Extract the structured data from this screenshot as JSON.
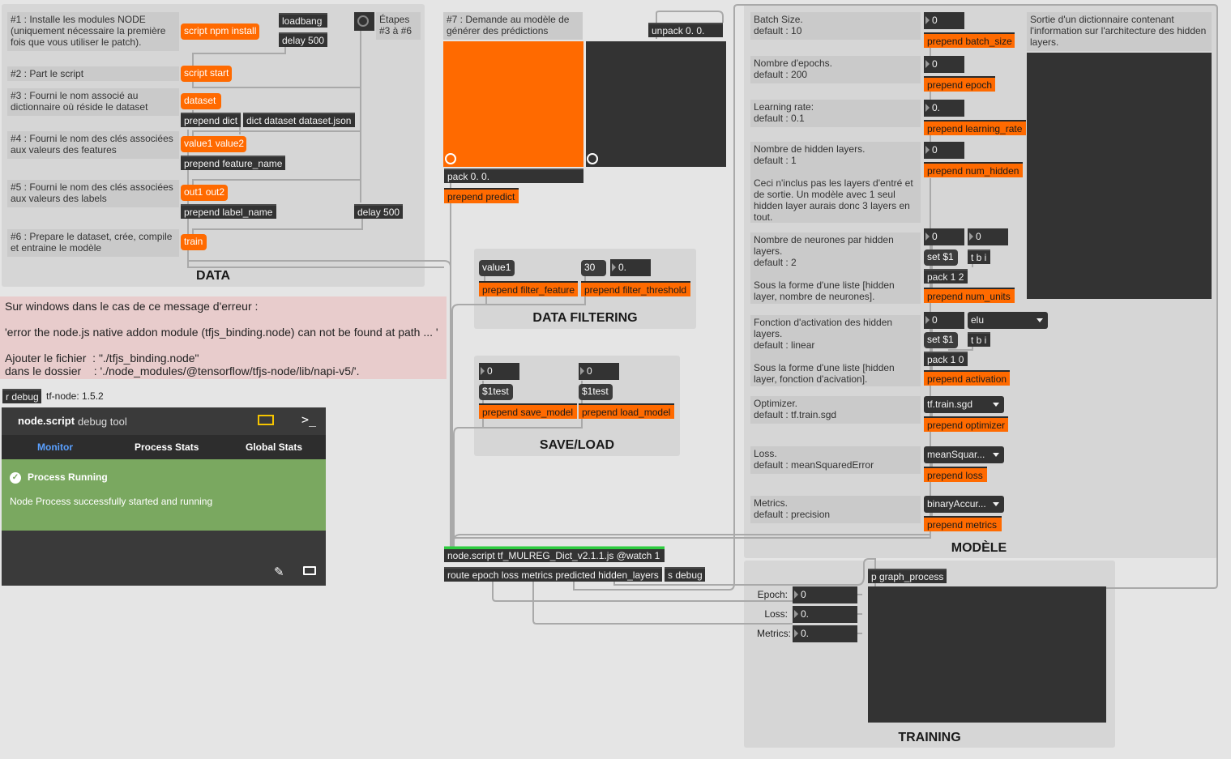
{
  "data_panel": {
    "title": "DATA",
    "comments": {
      "c1": "#1 : Installe les modules NODE (uniquement nécessaire la première fois que vous utiliser le patch).",
      "c2": "#2 : Part le script",
      "c3": "#3 : Fourni le nom associé au dictionnaire où réside le dataset",
      "c4": "#4 : Fourni le nom des clés associées aux valeurs des features",
      "c5": "#5 : Fourni le nom des clés associées aux valeurs des labels",
      "c6": "#6 : Prepare le dataset, crée, compile et entraine le modèle",
      "steps": "Étapes\n#3 à #6"
    },
    "messages": {
      "npm_install": "script npm install",
      "start": "script start",
      "dataset": "dataset",
      "features": "value1 value2",
      "labels": "out1 out2",
      "train": "train"
    },
    "objects": {
      "loadbang": "loadbang",
      "delay1": "delay 500",
      "prepend_dict": "prepend dict",
      "dict": "dict dataset dataset.json",
      "prepend_feature": "prepend feature_name",
      "prepend_label": "prepend label_name",
      "delay2": "delay 500"
    }
  },
  "predict": {
    "comment": "#7 : Demande au modèle de générer des prédictions",
    "unpack": "unpack 0. 0.",
    "pack": "pack 0. 0.",
    "prepend": "prepend predict"
  },
  "filtering": {
    "title": "DATA FILTERING",
    "value_msg": "value1",
    "threshold_msg": "30",
    "threshold_num": "0.",
    "prepend_feature": "prepend filter_feature",
    "prepend_threshold": "prepend filter_threshold"
  },
  "saveload": {
    "title": "SAVE/LOAD",
    "num1": "0",
    "num2": "0",
    "msg1": "$1test",
    "msg2": "$1test",
    "prepend_save": "prepend save_model",
    "prepend_load": "prepend load_model"
  },
  "error_note": {
    "text": "Sur windows dans le cas de ce message d'erreur :\n\n'error the node.js native addon module (tfjs_binding.node) can not be found at path ... '\n\nAjouter le fichier  : \"./tfjs_binding.node\"\ndans le dossier    : './node_modules/@tensorflow/tfjs-node/lib/napi-v5/'."
  },
  "debug": {
    "receive": "r debug",
    "version": "tf-node: 1.5.2",
    "brand": "node.script",
    "brand_sub": "debug tool",
    "tabs": [
      "Monitor",
      "Process Stats",
      "Global Stats"
    ],
    "status_title": "Process Running",
    "status_text": "Node Process successfully started and running",
    "colors": {
      "accent": "#5aa0ff",
      "status_bg": "#7aa860",
      "header_bg": "#3a3a3a"
    }
  },
  "model_panel": {
    "title": "MODÈLE",
    "batch": {
      "comment": "Batch Size.\ndefault : 10",
      "num": "0",
      "prepend": "prepend batch_size"
    },
    "epoch": {
      "comment": "Nombre d'epochs.\ndefault : 200",
      "num": "0",
      "prepend": "prepend epoch"
    },
    "lr": {
      "comment": "Learning rate:\ndefault : 0.1",
      "num": "0.",
      "prepend": "prepend learning_rate"
    },
    "hidden": {
      "comment": "Nombre de hidden layers.\ndefault : 1\n\nCeci n'inclus pas les layers d'entré et de sortie. Un modèle avec 1 seul hidden layer aurais donc 3 layers en tout.",
      "num": "0",
      "prepend": "prepend num_hidden"
    },
    "units": {
      "comment": "Nombre de neurones par hidden layers.\ndefault : 2\n\nSous la forme d'une liste [hidden layer, nombre de neurones].",
      "num1": "0",
      "num2": "0",
      "set": "set $1",
      "tbi": "t b i",
      "pack": "pack 1 2",
      "prepend": "prepend num_units"
    },
    "activation": {
      "comment": "Fonction d'activation des hidden layers.\ndefault : linear\n\nSous la forme d'une liste [hidden layer, fonction d'acivation].",
      "num": "0",
      "menu": "elu",
      "set": "set $1",
      "tbi": "t b i",
      "pack": "pack 1 0",
      "prepend": "prepend activation"
    },
    "optimizer": {
      "comment": "Optimizer.\ndefault : tf.train.sgd",
      "menu": "tf.train.sgd",
      "prepend": "prepend optimizer"
    },
    "loss": {
      "comment": "Loss.\ndefault : meanSquaredError",
      "menu": "meanSquar...",
      "prepend": "prepend loss"
    },
    "metrics": {
      "comment": "Metrics.\ndefault : precision",
      "menu": "binaryAccur...",
      "prepend": "prepend metrics"
    },
    "output_comment": "Sortie d'un dictionnaire contenant l'information sur l'architecture des hidden layers."
  },
  "node_script": {
    "main": "node.script tf_MULREG_Dict_v2.1.1.js @watch 1",
    "route": "route epoch loss metrics predicted hidden_layers",
    "send_debug": "s debug"
  },
  "training": {
    "title": "TRAINING",
    "graph": "p graph_process",
    "labels": [
      "Epoch:",
      "Loss:",
      "Metrics:"
    ],
    "values": [
      "0",
      "0.",
      "0."
    ]
  }
}
